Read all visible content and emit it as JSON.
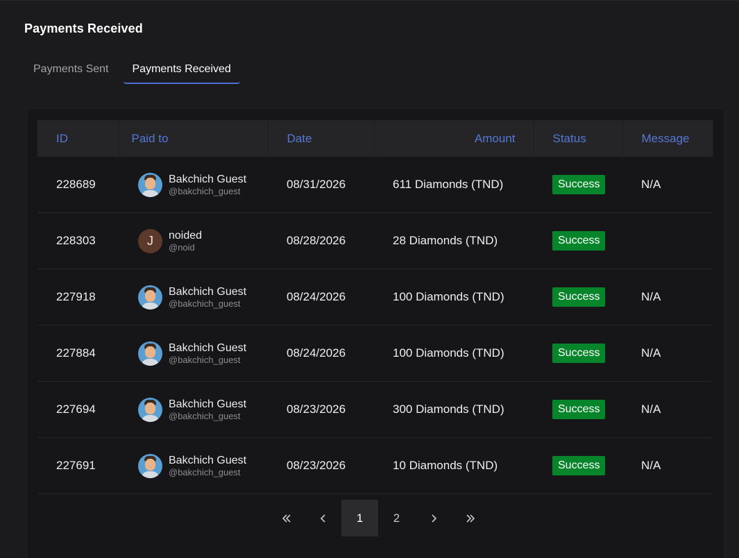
{
  "page": {
    "title": "Payments Received"
  },
  "tabs": [
    {
      "label": "Payments Sent",
      "active": false
    },
    {
      "label": "Payments Received",
      "active": true
    }
  ],
  "table": {
    "headers": {
      "id": "ID",
      "paid_to": "Paid to",
      "date": "Date",
      "amount": "Amount",
      "status": "Status",
      "message": "Message"
    },
    "rows": [
      {
        "id": "228689",
        "name": "Bakchich Guest",
        "handle": "@bakchich_guest",
        "avatar": "person-avatar",
        "date": "08/31/2026",
        "amount": "611 Diamonds (TND)",
        "status": "Success",
        "message": "N/A"
      },
      {
        "id": "228303",
        "name": "noided",
        "handle": "@noid",
        "avatar_letter": "J",
        "date": "08/28/2026",
        "amount": "28 Diamonds (TND)",
        "status": "Success",
        "message": ""
      },
      {
        "id": "227918",
        "name": "Bakchich Guest",
        "handle": "@bakchich_guest",
        "avatar": "person-avatar",
        "date": "08/24/2026",
        "amount": "100 Diamonds (TND)",
        "status": "Success",
        "message": "N/A"
      },
      {
        "id": "227884",
        "name": "Bakchich Guest",
        "handle": "@bakchich_guest",
        "avatar": "person-avatar",
        "date": "08/24/2026",
        "amount": "100 Diamonds (TND)",
        "status": "Success",
        "message": "N/A"
      },
      {
        "id": "227694",
        "name": "Bakchich Guest",
        "handle": "@bakchich_guest",
        "avatar": "person-avatar",
        "date": "08/23/2026",
        "amount": "300 Diamonds (TND)",
        "status": "Success",
        "message": "N/A"
      },
      {
        "id": "227691",
        "name": "Bakchich Guest",
        "handle": "@bakchich_guest",
        "avatar": "person-avatar",
        "date": "08/23/2026",
        "amount": "10 Diamonds (TND)",
        "status": "Success",
        "message": "N/A"
      }
    ]
  },
  "pagination": {
    "first_icon": "double-chevron-left-icon",
    "prev_icon": "chevron-left-icon",
    "pages": [
      "1",
      "2"
    ],
    "current": "1",
    "next_icon": "chevron-right-icon",
    "last_icon": "double-chevron-right-icon"
  },
  "colors": {
    "accent": "#4f6fd6",
    "header_text": "#5578d4",
    "success": "#07852b",
    "background": "#1b1b1d"
  }
}
